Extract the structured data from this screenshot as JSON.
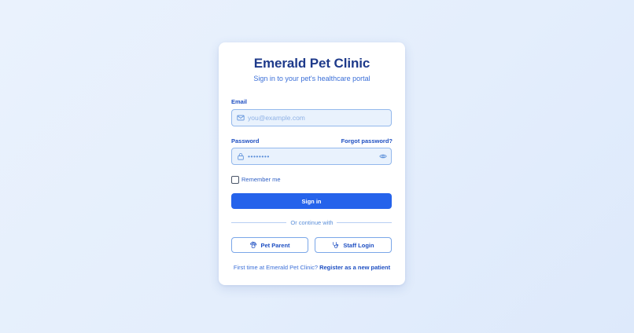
{
  "header": {
    "title": "Emerald Pet Clinic",
    "subtitle": "Sign in to your pet's healthcare portal"
  },
  "form": {
    "email": {
      "label": "Email",
      "placeholder": "you@example.com",
      "value": "",
      "icon": "mail-icon"
    },
    "password": {
      "label": "Password",
      "forgot_label": "Forgot password?",
      "masked_value": "••••••••",
      "icon": "lock-icon",
      "toggle_icon": "eye-icon"
    },
    "remember": {
      "label": "Remember me",
      "checked": false
    },
    "submit_label": "Sign in"
  },
  "divider": {
    "text": "Or continue with"
  },
  "alternatives": [
    {
      "label": "Pet Parent",
      "icon": "paw-icon"
    },
    {
      "label": "Staff Login",
      "icon": "stethoscope-icon"
    }
  ],
  "footer": {
    "prompt": "First time at Emerald Pet Clinic?",
    "link_label": "Register as a new patient"
  },
  "colors": {
    "primary": "#2563eb",
    "heading": "#1e3a8a",
    "link": "#1e4fc2",
    "field_bg": "#e9f2fd",
    "field_border": "#93b8ec"
  }
}
